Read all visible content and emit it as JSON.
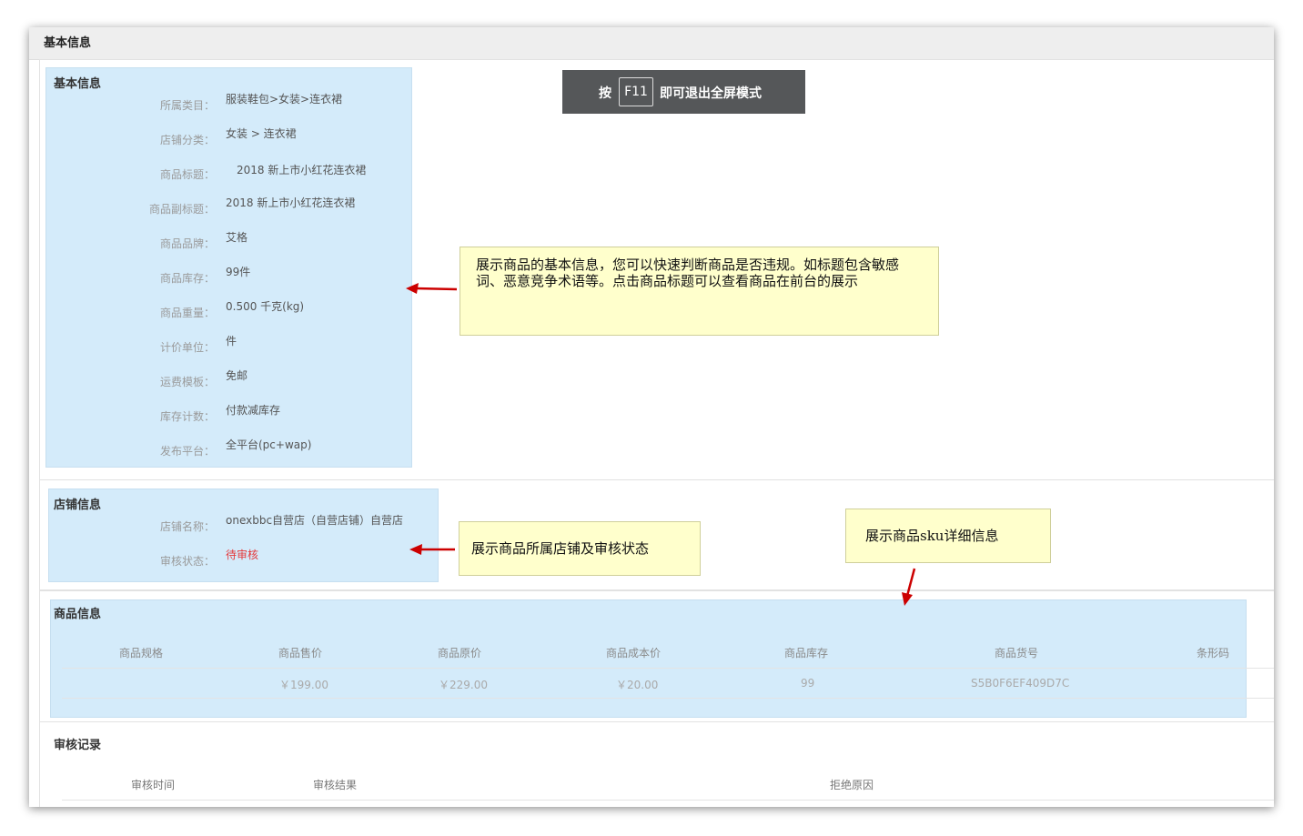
{
  "window_title": "基本信息",
  "basic": {
    "title": "基本信息",
    "fields": [
      {
        "label": "所属类目：",
        "value": "服装鞋包>女装>连衣裙"
      },
      {
        "label": "店铺分类：",
        "value": "女装 > 连衣裙"
      },
      {
        "label": "商品标题：",
        "value": "2018 新上市小红花连衣裙"
      },
      {
        "label": "商品副标题：",
        "value": "2018 新上市小红花连衣裙"
      },
      {
        "label": "商品品牌：",
        "value": "艾格"
      },
      {
        "label": "商品库存：",
        "value": "99件"
      },
      {
        "label": "商品重量：",
        "value": "0.500 千克(kg)"
      },
      {
        "label": "计价单位：",
        "value": "件"
      },
      {
        "label": "运费模板：",
        "value": "免邮"
      },
      {
        "label": "库存计数：",
        "value": "付款减库存"
      },
      {
        "label": "发布平台：",
        "value": "全平台(pc+wap)"
      }
    ]
  },
  "fullscreen_banner": {
    "prefix": "按",
    "key": "F11",
    "suffix": "即可退出全屏模式"
  },
  "notes": {
    "basic": "展示商品的基本信息，您可以快速判断商品是否违规。如标题包含敏感词、恶意竞争术语等。点击商品标题可以查看商品在前台的展示",
    "shop": "展示商品所属店铺及审核状态",
    "sku": "展示商品sku详细信息"
  },
  "shop": {
    "title": "店铺信息",
    "name_label": "店铺名称：",
    "name_value": "onexbbc自营店（自营店铺）自营店",
    "status_label": "审核状态：",
    "status_value": "待审核",
    "status_color": "#e4393c"
  },
  "goods": {
    "title": "商品信息",
    "headers": [
      "商品规格",
      "商品售价",
      "商品原价",
      "商品成本价",
      "商品库存",
      "商品货号",
      "条形码"
    ],
    "row": [
      "",
      "￥199.00",
      "￥229.00",
      "￥20.00",
      "99",
      "S5B0F6EF409D7C",
      ""
    ]
  },
  "audit": {
    "title": "审核记录",
    "headers": [
      "审核时间",
      "审核结果",
      "拒绝原因"
    ]
  },
  "colors": {
    "highlight": "#d4ebfa",
    "note": "#ffffcc",
    "arrow": "#cc0000",
    "banner": "#555759"
  }
}
